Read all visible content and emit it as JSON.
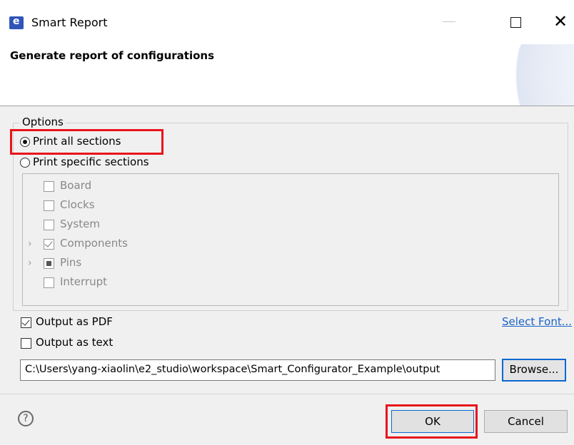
{
  "window": {
    "title": "Smart Report"
  },
  "banner": {
    "title": "Generate report of configurations"
  },
  "options": {
    "group_label": "Options",
    "radio_all": {
      "label": "Print all sections",
      "selected": true
    },
    "radio_specific": {
      "label": "Print specific sections",
      "selected": false
    },
    "sections": [
      {
        "label": "Board",
        "state": "unchecked",
        "expandable": false
      },
      {
        "label": "Clocks",
        "state": "unchecked",
        "expandable": false
      },
      {
        "label": "System",
        "state": "unchecked",
        "expandable": false
      },
      {
        "label": "Components",
        "state": "checked",
        "expandable": true
      },
      {
        "label": "Pins",
        "state": "partial",
        "expandable": true
      },
      {
        "label": "Interrupt",
        "state": "unchecked",
        "expandable": false
      }
    ]
  },
  "output": {
    "pdf": {
      "label": "Output as PDF",
      "checked": true
    },
    "text": {
      "label": "Output as text",
      "checked": false
    },
    "select_font_link": "Select Font...",
    "path": "C:\\Users\\yang-xiaolin\\e2_studio\\workspace\\Smart_Configurator_Example\\output",
    "browse_label": "Browse..."
  },
  "footer": {
    "help": "?",
    "ok_label": "OK",
    "cancel_label": "Cancel"
  },
  "colors": {
    "highlight": "#e8141b",
    "link": "#1a62c8",
    "focus": "#0b68d0"
  }
}
